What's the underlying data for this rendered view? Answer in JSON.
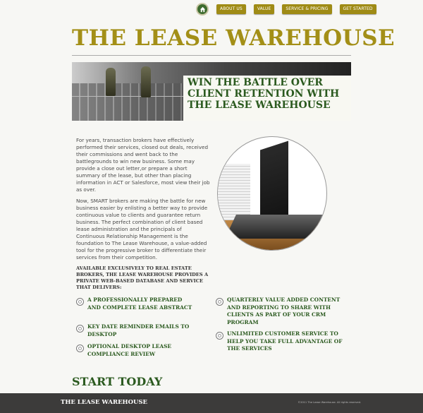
{
  "nav": {
    "home_icon": "home-icon",
    "items": [
      {
        "label": "ABOUT US"
      },
      {
        "label": "VALUE"
      },
      {
        "label": "SERVICE & PRICING"
      },
      {
        "label": "GET STARTED"
      }
    ]
  },
  "logo": "THE LEASE WAREHOUSE",
  "banner": {
    "headline_1": "WIN THE BATTLE OVER",
    "headline_2": "CLIENT RETENTION WITH",
    "headline_3": "THE LEASE WAREHOUSE"
  },
  "body": {
    "p1": "For years, transaction brokers have effectively performed their services, closed out deals, received their commissions and went back to the battlegrounds to win new business. Some may provide a close out letter,or prepare a short summary of the lease, but other than placing information in ACT or Salesforce, most view their job as over.",
    "p2": "Now, SMART brokers are making the battle for new business easier by enlisting a better way to provide continuous value to clients and guarantee return business. The perfect combination of client based lease administration and the principals of Continuous Relationship Management is the foundation to The Lease Warehouse, a value-added tool for the progressive broker to differentiate their services from their competition.",
    "p3": "AVAILABLE EXCLUSIVELY TO REAL ESTATE BROKERS, THE LEASE WAREHOUSE PROVIDES A PRIVATE WEB-BASED DATABASE AND SERVICE THAT DELIVERS:"
  },
  "features": {
    "left": [
      "A PROFESSIONALLY PREPARED AND COMPLETE LEASE ABSTRACT",
      "KEY DATE REMINDER EMAILS TO DESKTOP",
      "OPTIONAL DESKTOP LEASE COMPLIANCE REVIEW"
    ],
    "right": [
      "QUARTERLY VALUE ADDED CONTENT AND REPORTING TO SHARE WITH CLIENTS AS PART OF YOUR CRM PROGRAM",
      "UNLIMITED CUSTOMER SERVICE TO HELP YOU TAKE FULL ADVANTAGE OF THE SERVICES"
    ]
  },
  "cta": "START TODAY",
  "footer": {
    "brand": "THE LEASE WAREHOUSE",
    "copyright": "©2011 The Lease Warehouse. All rights reserved."
  },
  "colors": {
    "gold": "#a38f17",
    "green": "#2b5a1f",
    "footer_bg": "#3c3b3a"
  }
}
